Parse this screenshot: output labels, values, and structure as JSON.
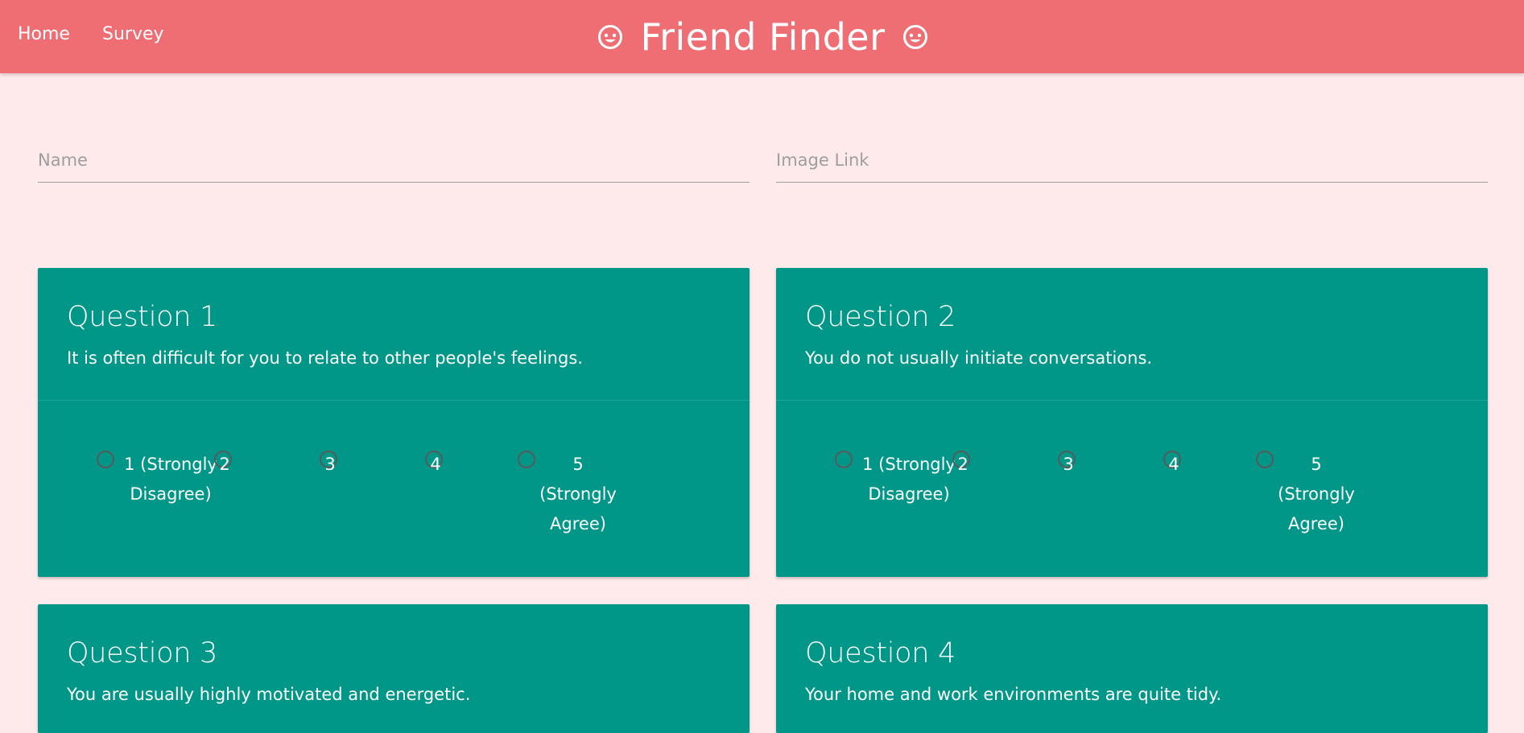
{
  "nav": {
    "home_label": "Home",
    "survey_label": "Survey",
    "brand_title": "Friend Finder"
  },
  "form": {
    "name_placeholder": "Name",
    "image_placeholder": "Image Link"
  },
  "scale": {
    "opt1": "1 (Strongly Disagree)",
    "opt2": "2",
    "opt3": "3",
    "opt4": "4",
    "opt5": "5 (Strongly Agree)"
  },
  "questions": [
    {
      "title": "Question 1",
      "text": "It is often difficult for you to relate to other people's feelings."
    },
    {
      "title": "Question 2",
      "text": "You do not usually initiate conversations."
    },
    {
      "title": "Question 3",
      "text": "You are usually highly motivated and energetic."
    },
    {
      "title": "Question 4",
      "text": "Your home and work environments are quite tidy."
    }
  ],
  "colors": {
    "navbar": "#ef6e74",
    "background": "#ffeaeb",
    "card": "#009688"
  }
}
